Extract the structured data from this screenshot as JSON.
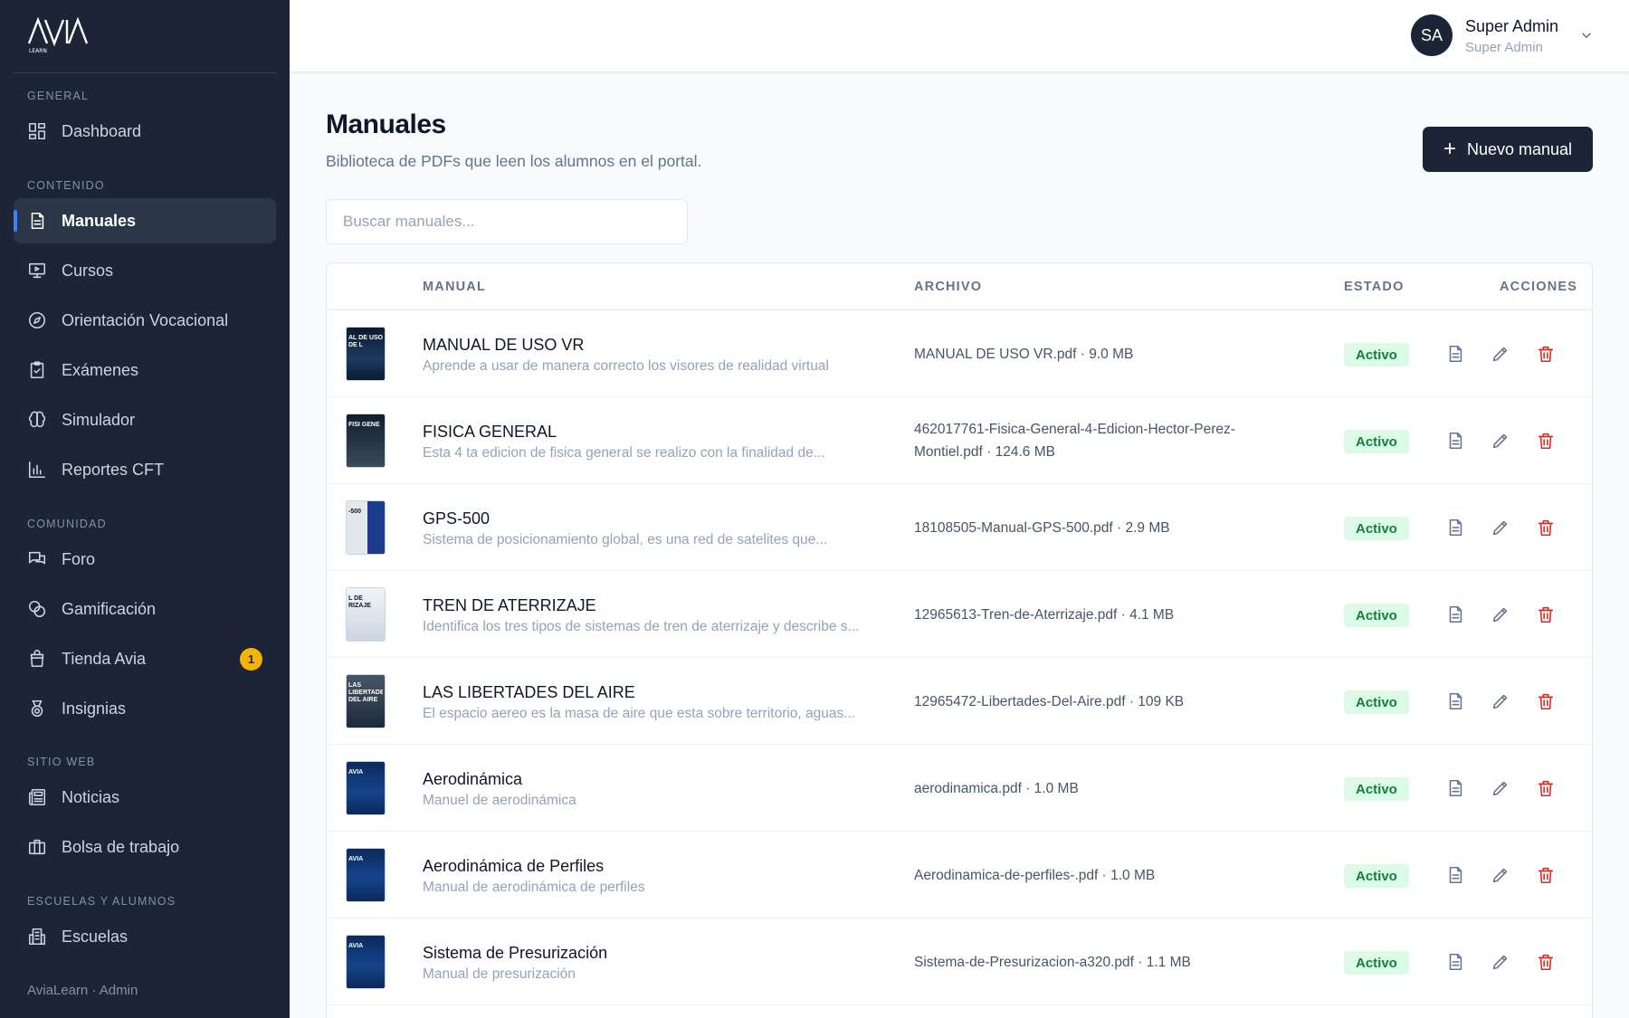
{
  "brand": {
    "logo_text": "AVIA",
    "logo_sub": "LEARN"
  },
  "sidebar": {
    "sections": [
      {
        "label": "GENERAL",
        "items": [
          {
            "label": "Dashboard",
            "icon": "dashboard-icon"
          }
        ]
      },
      {
        "label": "CONTENIDO",
        "items": [
          {
            "label": "Manuales",
            "icon": "document-icon",
            "active": true
          },
          {
            "label": "Cursos",
            "icon": "presentation-icon"
          },
          {
            "label": "Orientación Vocacional",
            "icon": "compass-icon"
          },
          {
            "label": "Exámenes",
            "icon": "clipboard-check-icon"
          },
          {
            "label": "Simulador",
            "icon": "brain-icon"
          },
          {
            "label": "Reportes CFT",
            "icon": "bar-chart-icon"
          }
        ]
      },
      {
        "label": "COMUNIDAD",
        "items": [
          {
            "label": "Foro",
            "icon": "chat-icon"
          },
          {
            "label": "Gamificación",
            "icon": "coins-icon"
          },
          {
            "label": "Tienda Avia",
            "icon": "shopping-bag-icon",
            "badge": "1"
          },
          {
            "label": "Insignias",
            "icon": "medal-icon"
          }
        ]
      },
      {
        "label": "SITIO WEB",
        "items": [
          {
            "label": "Noticias",
            "icon": "newspaper-icon"
          },
          {
            "label": "Bolsa de trabajo",
            "icon": "briefcase-icon"
          }
        ]
      },
      {
        "label": "ESCUELAS Y ALUMNOS",
        "items": [
          {
            "label": "Escuelas",
            "icon": "building-icon"
          }
        ]
      }
    ],
    "footer": "AviaLearn · Admin"
  },
  "topbar": {
    "avatar_initials": "SA",
    "user_name": "Super Admin",
    "user_role": "Super Admin"
  },
  "page": {
    "title": "Manuales",
    "subtitle": "Biblioteca de PDFs que leen los alumnos en el portal.",
    "new_button": "Nuevo manual",
    "search_placeholder": "Buscar manuales..."
  },
  "table": {
    "headers": {
      "manual": "MANUAL",
      "archivo": "ARCHIVO",
      "estado": "ESTADO",
      "acciones": "ACCIONES"
    },
    "rows": [
      {
        "title": "MANUAL DE USO VR",
        "desc": "Aprende a usar de manera correcto los visores de realidad virtual",
        "file": "MANUAL DE USO VR.pdf · 9.0 MB",
        "status": "Activo",
        "thumb_text": "AL DE USO DE L",
        "thumb_style": "dark"
      },
      {
        "title": "FISICA GENERAL",
        "desc": "Esta 4 ta edicion de fisica general se realizo con la finalidad de...",
        "file": "462017761-Fisica-General-4-Edicion-Hector-Perez-Montiel.pdf · 124.6 MB",
        "status": "Activo",
        "thumb_text": "FÍSI GENE",
        "thumb_style": "space"
      },
      {
        "title": "GPS-500",
        "desc": "Sistema de posicionamiento global, es una red de satelites que...",
        "file": "18108505-Manual-GPS-500.pdf · 2.9 MB",
        "status": "Activo",
        "thumb_text": "-500",
        "thumb_style": "gps"
      },
      {
        "title": "TREN DE ATERRIZAJE",
        "desc": "Identifica los tres tipos de sistemas de tren de aterrizaje y describe s...",
        "file": "12965613-Tren-de-Aterrizaje.pdf · 4.1 MB",
        "status": "Activo",
        "thumb_text": "L DE RIZAJE",
        "thumb_style": "light"
      },
      {
        "title": "LAS LIBERTADES DEL AIRE",
        "desc": "El espacio aereo es la masa de aire que esta sobre territorio, aguas...",
        "file": "12965472-Libertades-Del-Aire.pdf · 109 KB",
        "status": "Activo",
        "thumb_text": "LAS LIBERTADES DEL AIRE",
        "thumb_style": "gray"
      },
      {
        "title": "Aerodinámica",
        "desc": "Manuel de aerodinámica",
        "file": "aerodinamica.pdf · 1.0 MB",
        "status": "Activo",
        "thumb_text": "AVIA",
        "thumb_style": "blue"
      },
      {
        "title": "Aerodinámica de Perfiles",
        "desc": "Manual de aerodinámica de perfiles",
        "file": "Aerodinamica-de-perfiles-.pdf · 1.0 MB",
        "status": "Activo",
        "thumb_text": "AVIA",
        "thumb_style": "blue"
      },
      {
        "title": "Sistema de Presurización",
        "desc": "Manual de presurización",
        "file": "Sistema-de-Presurizacion-a320.pdf · 1.1 MB",
        "status": "Activo",
        "thumb_text": "AVIA",
        "thumb_style": "blue"
      }
    ]
  },
  "colors": {
    "sidebar_bg": "#1b2535",
    "accent": "#3b82f6",
    "status_bg": "#dcfce7",
    "status_fg": "#15803d",
    "delete": "#dc2626",
    "badge": "#f5b301"
  }
}
